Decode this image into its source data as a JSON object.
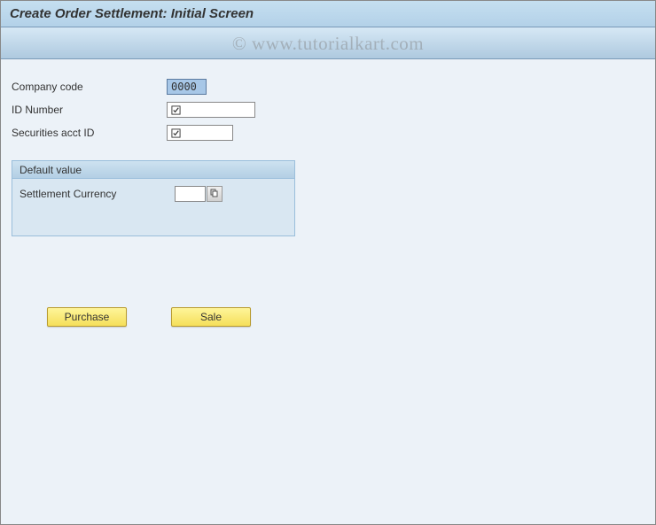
{
  "header": {
    "title": "Create Order Settlement: Initial Screen"
  },
  "watermark": "© www.tutorialkart.com",
  "form": {
    "companyCode": {
      "label": "Company code",
      "value": "0000"
    },
    "idNumber": {
      "label": "ID Number",
      "value": ""
    },
    "securitiesAcctId": {
      "label": "Securities acct ID",
      "value": ""
    }
  },
  "groupBox": {
    "title": "Default value",
    "settlementCurrency": {
      "label": "Settlement Currency",
      "value": ""
    }
  },
  "buttons": {
    "purchase": "Purchase",
    "sale": "Sale"
  }
}
